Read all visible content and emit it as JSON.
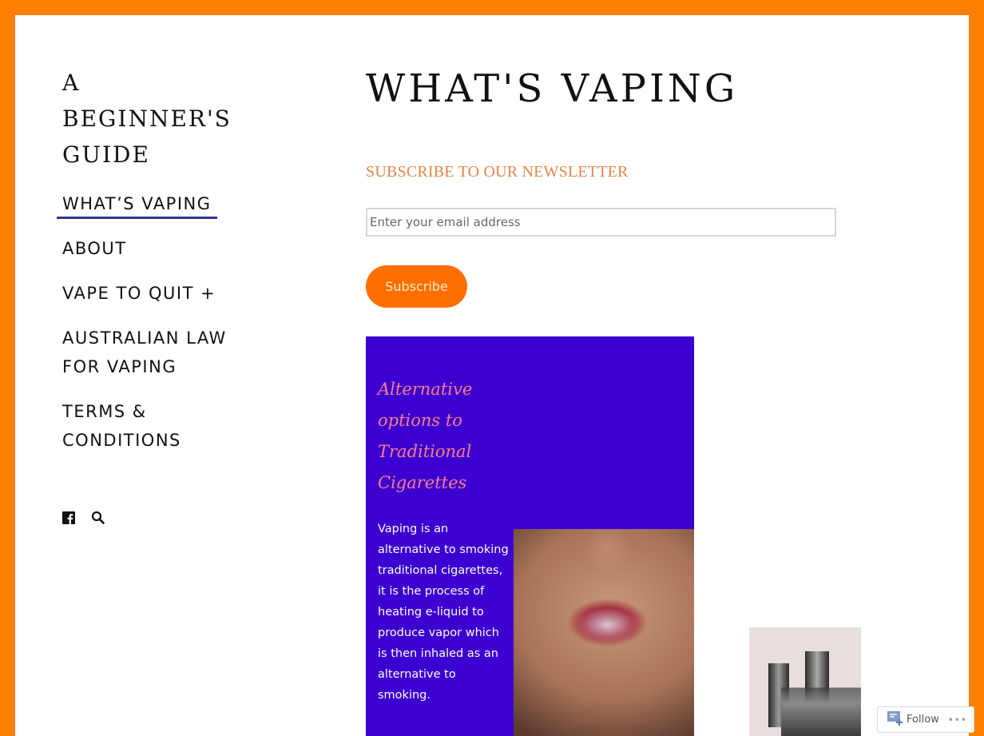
{
  "site": {
    "title": "A BEGINNER'S GUIDE"
  },
  "nav": {
    "items": [
      {
        "label": "WHAT’S VAPING",
        "current": true
      },
      {
        "label": "ABOUT",
        "current": false
      },
      {
        "label": "VAPE TO QUIT +",
        "current": false
      },
      {
        "label": "AUSTRALIAN LAW FOR VAPING",
        "current": false
      },
      {
        "label": "TERMS & CONDITIONS",
        "current": false
      }
    ]
  },
  "social": {
    "icons": [
      "facebook-icon",
      "search-icon"
    ]
  },
  "main": {
    "title": "WHAT'S VAPING",
    "newsletter": {
      "heading": "SUBSCRIBE TO OUR NEWSLETTER",
      "email_placeholder": "Enter your email address",
      "email_value": "",
      "subscribe_label": "Subscribe"
    },
    "feature": {
      "heading": "Alternative options to Traditional Cigarettes",
      "body": "Vaping is an alternative to smoking traditional cigarettes, it is the process of heating e-liquid to produce vapor which is then inhaled as an alternative to smoking."
    }
  },
  "follow_bar": {
    "follow_label": "Follow",
    "more_label": "•••"
  },
  "colors": {
    "frame": "#ff8000",
    "accent_button": "#ff6f00",
    "newsletter_heading": "#e0874a",
    "feature_bg": "#3b00d1",
    "feature_heading": "#ff7a8a",
    "nav_underline": "#2b3a9b"
  }
}
